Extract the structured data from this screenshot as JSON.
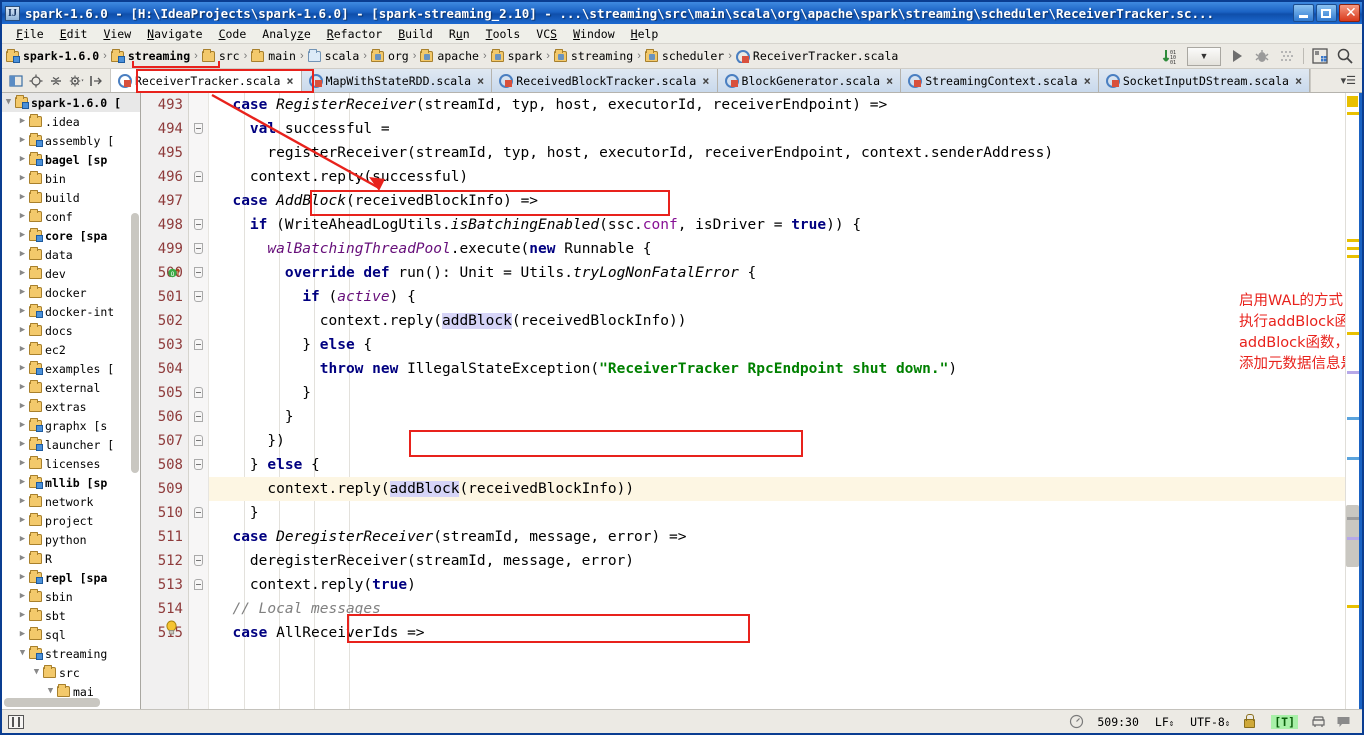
{
  "window": {
    "title": "spark-1.6.0 - [H:\\IdeaProjects\\spark-1.6.0] - [spark-streaming_2.10] - ...\\streaming\\src\\main\\scala\\org\\apache\\spark\\streaming\\scheduler\\ReceiverTracker.sc...",
    "app_icon": "IJ",
    "minimize": "minimize-button",
    "maximize": "maximize-button",
    "close": "close-button"
  },
  "menubar": {
    "items": [
      {
        "label": "File",
        "mnemonic": "F"
      },
      {
        "label": "Edit",
        "mnemonic": "E"
      },
      {
        "label": "View",
        "mnemonic": "V"
      },
      {
        "label": "Navigate",
        "mnemonic": "N"
      },
      {
        "label": "Code",
        "mnemonic": "C"
      },
      {
        "label": "Analyze",
        "mnemonic": "z"
      },
      {
        "label": "Refactor",
        "mnemonic": "R"
      },
      {
        "label": "Build",
        "mnemonic": "B"
      },
      {
        "label": "Run",
        "mnemonic": "u"
      },
      {
        "label": "Tools",
        "mnemonic": "T"
      },
      {
        "label": "VCS",
        "mnemonic": "S"
      },
      {
        "label": "Window",
        "mnemonic": "W"
      },
      {
        "label": "Help",
        "mnemonic": "H"
      }
    ]
  },
  "breadcrumb": {
    "items": [
      {
        "label": "spark-1.6.0",
        "icon": "module-folder-icon",
        "bold": true
      },
      {
        "label": "streaming",
        "icon": "module-folder-icon",
        "bold": true
      },
      {
        "label": "src",
        "icon": "folder-icon",
        "bold": false
      },
      {
        "label": "main",
        "icon": "folder-icon",
        "bold": false
      },
      {
        "label": "scala",
        "icon": "source-folder-icon",
        "bold": false
      },
      {
        "label": "org",
        "icon": "package-icon",
        "bold": false
      },
      {
        "label": "apache",
        "icon": "package-icon",
        "bold": false
      },
      {
        "label": "spark",
        "icon": "package-icon",
        "bold": false
      },
      {
        "label": "streaming",
        "icon": "package-icon",
        "bold": false
      },
      {
        "label": "scheduler",
        "icon": "package-icon",
        "bold": false
      },
      {
        "label": "ReceiverTracker.scala",
        "icon": "scala-file-icon",
        "bold": false
      }
    ],
    "separator": "›"
  },
  "toolbar_right": {
    "icons": [
      "sort-numeric-icon",
      "dropdown-selector",
      "run-icon",
      "debug-icon",
      "coverage-icon",
      "project-structure-icon",
      "search-icon"
    ]
  },
  "tabs_lead_icons": [
    "project-view-icon",
    "locate-icon",
    "collapse-all-icon",
    "settings-icon",
    "hide-icon"
  ],
  "editor_tabs": [
    {
      "label": "ReceiverTracker.scala",
      "active": true,
      "close": "×"
    },
    {
      "label": "MapWithStateRDD.scala",
      "active": false,
      "close": "×"
    },
    {
      "label": "ReceivedBlockTracker.scala",
      "active": false,
      "close": "×"
    },
    {
      "label": "BlockGenerator.scala",
      "active": false,
      "close": "×"
    },
    {
      "label": "StreamingContext.scala",
      "active": false,
      "close": "×"
    },
    {
      "label": "SocketInputDStream.scala",
      "active": false,
      "close": "×"
    }
  ],
  "project_tree": [
    {
      "label": "spark-1.6.0 [",
      "depth": 0,
      "expanded": true,
      "icon": "module-folder-icon",
      "bold": true,
      "selected": true
    },
    {
      "label": ".idea",
      "depth": 1,
      "expanded": false,
      "icon": "folder-icon",
      "bold": false
    },
    {
      "label": "assembly [",
      "depth": 1,
      "expanded": false,
      "icon": "module-folder-icon",
      "bold": false
    },
    {
      "label": "bagel [sp",
      "depth": 1,
      "expanded": false,
      "icon": "module-folder-icon",
      "bold": true
    },
    {
      "label": "bin",
      "depth": 1,
      "expanded": false,
      "icon": "folder-icon",
      "bold": false
    },
    {
      "label": "build",
      "depth": 1,
      "expanded": false,
      "icon": "folder-icon",
      "bold": false
    },
    {
      "label": "conf",
      "depth": 1,
      "expanded": false,
      "icon": "folder-icon",
      "bold": false
    },
    {
      "label": "core [spa",
      "depth": 1,
      "expanded": false,
      "icon": "module-folder-icon",
      "bold": true
    },
    {
      "label": "data",
      "depth": 1,
      "expanded": false,
      "icon": "folder-icon",
      "bold": false
    },
    {
      "label": "dev",
      "depth": 1,
      "expanded": false,
      "icon": "folder-icon",
      "bold": false
    },
    {
      "label": "docker",
      "depth": 1,
      "expanded": false,
      "icon": "folder-icon",
      "bold": false
    },
    {
      "label": "docker-int",
      "depth": 1,
      "expanded": false,
      "icon": "module-folder-icon",
      "bold": false
    },
    {
      "label": "docs",
      "depth": 1,
      "expanded": false,
      "icon": "folder-icon",
      "bold": false
    },
    {
      "label": "ec2",
      "depth": 1,
      "expanded": false,
      "icon": "folder-icon",
      "bold": false
    },
    {
      "label": "examples [",
      "depth": 1,
      "expanded": false,
      "icon": "module-folder-icon",
      "bold": false
    },
    {
      "label": "external",
      "depth": 1,
      "expanded": false,
      "icon": "folder-icon",
      "bold": false
    },
    {
      "label": "extras",
      "depth": 1,
      "expanded": false,
      "icon": "folder-icon",
      "bold": false
    },
    {
      "label": "graphx [s",
      "depth": 1,
      "expanded": false,
      "icon": "module-folder-icon",
      "bold": false
    },
    {
      "label": "launcher [",
      "depth": 1,
      "expanded": false,
      "icon": "module-folder-icon",
      "bold": false
    },
    {
      "label": "licenses",
      "depth": 1,
      "expanded": false,
      "icon": "folder-icon",
      "bold": false
    },
    {
      "label": "mllib [sp",
      "depth": 1,
      "expanded": false,
      "icon": "module-folder-icon",
      "bold": true
    },
    {
      "label": "network",
      "depth": 1,
      "expanded": false,
      "icon": "folder-icon",
      "bold": false
    },
    {
      "label": "project",
      "depth": 1,
      "expanded": false,
      "icon": "folder-icon",
      "bold": false
    },
    {
      "label": "python",
      "depth": 1,
      "expanded": false,
      "icon": "folder-icon",
      "bold": false
    },
    {
      "label": "R",
      "depth": 1,
      "expanded": false,
      "icon": "folder-icon",
      "bold": false
    },
    {
      "label": "repl [spa",
      "depth": 1,
      "expanded": false,
      "icon": "module-folder-icon",
      "bold": true
    },
    {
      "label": "sbin",
      "depth": 1,
      "expanded": false,
      "icon": "folder-icon",
      "bold": false
    },
    {
      "label": "sbt",
      "depth": 1,
      "expanded": false,
      "icon": "folder-icon",
      "bold": false
    },
    {
      "label": "sql",
      "depth": 1,
      "expanded": false,
      "icon": "folder-icon",
      "bold": false
    },
    {
      "label": "streaming",
      "depth": 1,
      "expanded": true,
      "icon": "module-folder-icon",
      "bold": false
    },
    {
      "label": "src",
      "depth": 2,
      "expanded": true,
      "icon": "folder-icon",
      "bold": false
    },
    {
      "label": "mai",
      "depth": 3,
      "expanded": true,
      "icon": "folder-icon",
      "bold": false
    }
  ],
  "code": {
    "first_line": 493,
    "current_line": 509,
    "lines": [
      {
        "n": 493,
        "html": "  <span class=\"kw\">case</span> <span class=\"typ\">RegisterReceiver</span>(streamId, typ, host, executorId, receiverEndpoint) =&gt;"
      },
      {
        "n": 494,
        "html": "    <span class=\"kw\">val</span> successful ="
      },
      {
        "n": 495,
        "html": "      registerReceiver(streamId, typ, host, executorId, receiverEndpoint, context.senderAddress)"
      },
      {
        "n": 496,
        "html": "    context.reply(successful)"
      },
      {
        "n": 497,
        "html": "  <span class=\"kw\">case</span> <span class=\"typ\">AddBlock</span>(receivedBlockInfo) =&gt;"
      },
      {
        "n": 498,
        "html": "    <span class=\"kw\">if</span> (WriteAheadLogUtils.<span class=\"typ\">isBatchingEnabled</span>(ssc.<span class=\"fldp\">conf</span>, isDriver = <span class=\"kw\">true</span>)) {"
      },
      {
        "n": 499,
        "html": "      <span class=\"fld\">walBatchingThreadPool</span>.execute(<span class=\"kw\">new</span> Runnable {"
      },
      {
        "n": 500,
        "html": "        <span class=\"kw\">override def</span> run(): Unit = Utils.<span class=\"typ\">tryLogNonFatalError</span> {"
      },
      {
        "n": 501,
        "html": "          <span class=\"kw\">if</span> (<span class=\"fld\">active</span>) {"
      },
      {
        "n": 502,
        "html": "            context.reply(<span class=\"hl\">addBlock</span>(receivedBlockInfo))"
      },
      {
        "n": 503,
        "html": "          } <span class=\"kw\">else</span> {"
      },
      {
        "n": 504,
        "html": "            <span class=\"kw\">throw new</span> IllegalStateException(<span class=\"str\">\"ReceiverTracker RpcEndpoint shut down.\"</span>)"
      },
      {
        "n": 505,
        "html": "          }"
      },
      {
        "n": 506,
        "html": "        }"
      },
      {
        "n": 507,
        "html": "      })"
      },
      {
        "n": 508,
        "html": "    } <span class=\"kw\">else</span> {"
      },
      {
        "n": 509,
        "html": "      context.reply(<span class=\"hl\">addBlock</span>(receivedBlockInfo))"
      },
      {
        "n": 510,
        "html": "    }"
      },
      {
        "n": 511,
        "html": "  <span class=\"kw\">case</span> <span class=\"typ\">DeregisterReceiver</span>(streamId, message, error) =&gt;"
      },
      {
        "n": 512,
        "html": "    deregisterReceiver(streamId, message, error)"
      },
      {
        "n": 513,
        "html": "    context.reply(<span class=\"kw\">true</span>)"
      },
      {
        "n": 514,
        "html": "  <span class=\"cmt\">// Local messages</span>"
      },
      {
        "n": 515,
        "html": "  <span class=\"kw\">case</span> AllReceiverIds =&gt;"
      }
    ]
  },
  "annotation": {
    "note_lines": [
      "启用WAL的方式，则在线程池中",
      "执行addBlock函数，否则直接执行",
      "addBlock函数，回复给ReceiverSupervisorImpl",
      "添加元数据信息是否成功的结果"
    ],
    "color": "#e8221c"
  },
  "statusbar": {
    "position": "509:30",
    "line_separator": "LF",
    "encoding": "UTF-8",
    "lock": "lock-icon",
    "badge": "[T]",
    "badge_color": "#a8f0a8",
    "arrows": "↕"
  }
}
